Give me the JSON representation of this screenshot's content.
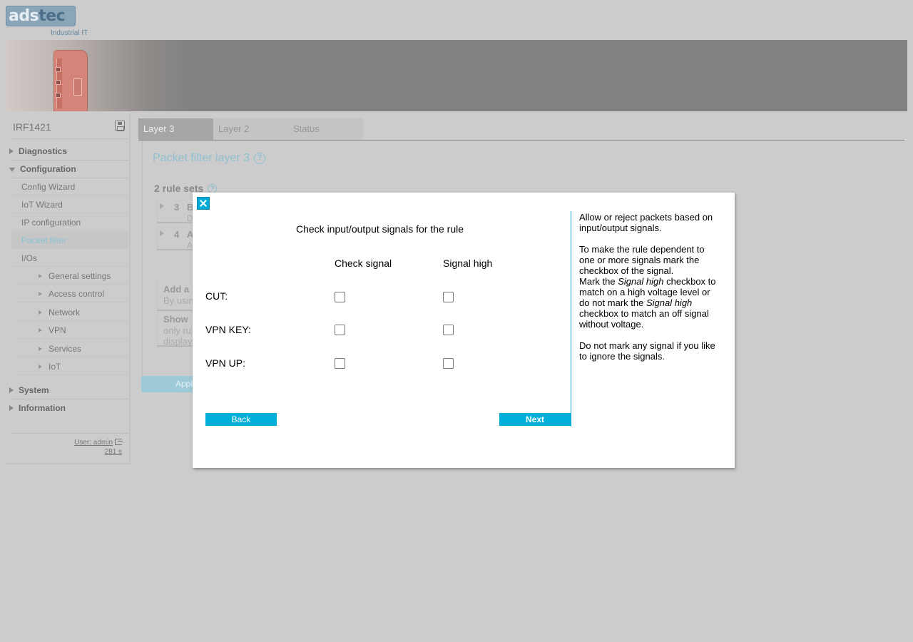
{
  "brand": {
    "logo_left": "ads",
    "logo_right": "tec",
    "tagline": "Industrial IT"
  },
  "sidebar": {
    "device_name": "IRF1421",
    "items": [
      {
        "label": "Diagnostics"
      },
      {
        "label": "Configuration"
      },
      {
        "label": "Config Wizard"
      },
      {
        "label": "IoT Wizard"
      },
      {
        "label": "IP configuration"
      },
      {
        "label": "Packet filter"
      },
      {
        "label": "I/Os"
      },
      {
        "label": "General settings"
      },
      {
        "label": "Access control"
      },
      {
        "label": "Network"
      },
      {
        "label": "VPN"
      },
      {
        "label": "Services"
      },
      {
        "label": "IoT"
      },
      {
        "label": "System"
      },
      {
        "label": "Information"
      }
    ],
    "user": "User: admin",
    "timer": "281 s"
  },
  "tabs": [
    {
      "label": "Layer 3"
    },
    {
      "label": "Layer 2"
    },
    {
      "label": "Status"
    }
  ],
  "main": {
    "title": "Packet filter layer 3",
    "rule_sets": "2 rule sets",
    "rules": [
      {
        "num": "3",
        "name": "B",
        "desc": "D"
      },
      {
        "num": "4",
        "name": "A",
        "desc": "A"
      }
    ],
    "add_box": {
      "heading": "Add a",
      "text": "By usin"
    },
    "show_box": {
      "heading": "Show",
      "line1": "only ru",
      "line2": "display"
    },
    "apply_label": "Appl"
  },
  "modal": {
    "title": "Check input/output signals for the rule",
    "col_check": "Check signal",
    "col_high": "Signal high",
    "signals": [
      {
        "label": "CUT:",
        "check": false,
        "high": false
      },
      {
        "label": "VPN KEY:",
        "check": false,
        "high": false
      },
      {
        "label": "VPN UP:",
        "check": false,
        "high": false
      }
    ],
    "back_label": "Back",
    "next_label": "Next",
    "help": {
      "p1": "Allow or reject packets based on input/output signals.",
      "p2": "To make the rule dependent to one or more signals mark the checkbox of the signal.",
      "p3a": "Mark the ",
      "p3b": "Signal high",
      "p3c": " checkbox to match on a high voltage level or do not mark the ",
      "p3d": "Signal high",
      "p3e": " checkbox to match an off signal without voltage.",
      "p4": "Do not mark any signal if you like to ignore the signals."
    }
  },
  "colors": {
    "accent": "#00afda",
    "background": "#cccccc"
  }
}
